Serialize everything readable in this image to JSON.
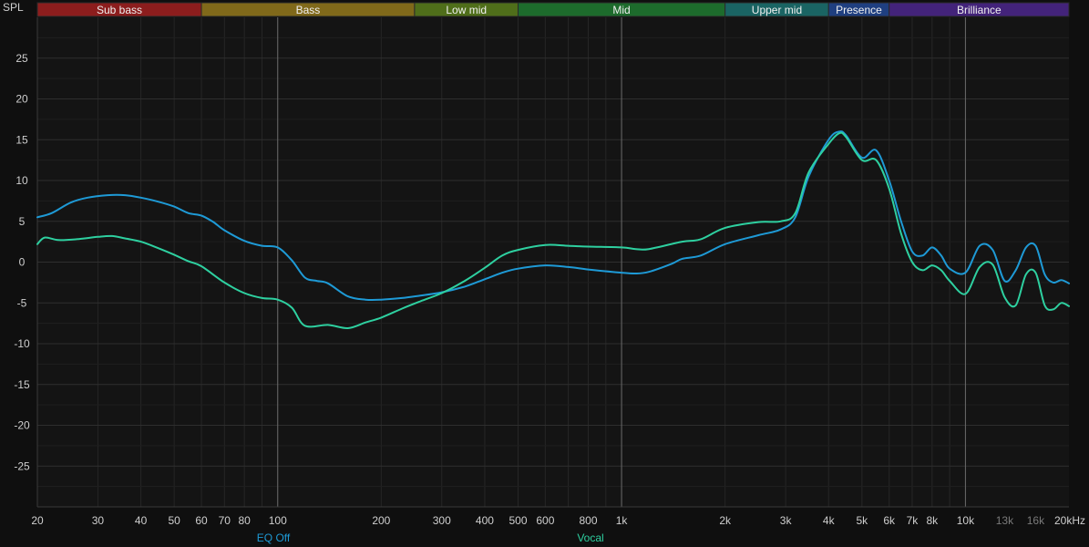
{
  "chart_data": {
    "type": "line",
    "ylabel": "SPL",
    "xscale": "log",
    "xlim": [
      20,
      20000
    ],
    "ylim": [
      -30,
      30
    ],
    "grid": true,
    "bands": [
      {
        "label": "Sub bass",
        "from": 20,
        "to": 60,
        "color": "#8c1d1d"
      },
      {
        "label": "Bass",
        "from": 60,
        "to": 250,
        "color": "#80691a"
      },
      {
        "label": "Low mid",
        "from": 250,
        "to": 500,
        "color": "#4f6e1a"
      },
      {
        "label": "Mid",
        "from": 500,
        "to": 2000,
        "color": "#1d6b2c"
      },
      {
        "label": "Upper mid",
        "from": 2000,
        "to": 4000,
        "color": "#1a6463"
      },
      {
        "label": "Presence",
        "from": 4000,
        "to": 6000,
        "color": "#1f3f80"
      },
      {
        "label": "Brilliance",
        "from": 6000,
        "to": 20000,
        "color": "#43237a"
      }
    ],
    "yticks": [
      {
        "value": 25,
        "label": "25"
      },
      {
        "value": 20,
        "label": "20"
      },
      {
        "value": 15,
        "label": "15"
      },
      {
        "value": 10,
        "label": "10"
      },
      {
        "value": 5,
        "label": "5"
      },
      {
        "value": 0,
        "label": "0"
      },
      {
        "value": -5,
        "label": "-5"
      },
      {
        "value": -10,
        "label": "-10"
      },
      {
        "value": -15,
        "label": "-15"
      },
      {
        "value": -20,
        "label": "-20"
      },
      {
        "value": -25,
        "label": "-25"
      }
    ],
    "xticks": [
      {
        "value": 20,
        "label": "20"
      },
      {
        "value": 30,
        "label": "30"
      },
      {
        "value": 40,
        "label": "40"
      },
      {
        "value": 50,
        "label": "50"
      },
      {
        "value": 60,
        "label": "60"
      },
      {
        "value": 70,
        "label": "70"
      },
      {
        "value": 80,
        "label": "80"
      },
      {
        "value": 100,
        "label": "100"
      },
      {
        "value": 200,
        "label": "200"
      },
      {
        "value": 300,
        "label": "300"
      },
      {
        "value": 400,
        "label": "400"
      },
      {
        "value": 500,
        "label": "500"
      },
      {
        "value": 600,
        "label": "600"
      },
      {
        "value": 800,
        "label": "800"
      },
      {
        "value": 1000,
        "label": "1k"
      },
      {
        "value": 2000,
        "label": "2k"
      },
      {
        "value": 3000,
        "label": "3k"
      },
      {
        "value": 4000,
        "label": "4k"
      },
      {
        "value": 5000,
        "label": "5k"
      },
      {
        "value": 6000,
        "label": "6k"
      },
      {
        "value": 7000,
        "label": "7k"
      },
      {
        "value": 8000,
        "label": "8k"
      },
      {
        "value": 10000,
        "label": "10k"
      },
      {
        "value": 13000,
        "label": "13k",
        "dim": true
      },
      {
        "value": 16000,
        "label": "16k",
        "dim": true
      },
      {
        "value": 20000,
        "label": "20kHz"
      }
    ],
    "series": [
      {
        "name": "EQ Off",
        "color": "#1e9ad6",
        "x": [
          20,
          22,
          25,
          28,
          32,
          36,
          40,
          45,
          50,
          55,
          60,
          65,
          70,
          80,
          90,
          100,
          110,
          120,
          130,
          140,
          160,
          180,
          200,
          230,
          260,
          300,
          350,
          400,
          450,
          500,
          600,
          700,
          800,
          1000,
          1100,
          1200,
          1400,
          1500,
          1700,
          2000,
          2500,
          2900,
          3200,
          3500,
          4000,
          4300,
          4500,
          5000,
          5500,
          6000,
          6500,
          7000,
          7500,
          8000,
          8500,
          9000,
          10000,
          11000,
          12000,
          13000,
          14000,
          15000,
          16000,
          17000,
          18000,
          19000,
          20000
        ],
        "y": [
          5.5,
          6.0,
          7.3,
          7.9,
          8.2,
          8.2,
          7.9,
          7.4,
          6.8,
          6.0,
          5.7,
          4.9,
          3.9,
          2.6,
          2.0,
          1.8,
          0.2,
          -1.9,
          -2.3,
          -2.6,
          -4.2,
          -4.6,
          -4.6,
          -4.4,
          -4.1,
          -3.7,
          -3.0,
          -2.1,
          -1.3,
          -0.8,
          -0.4,
          -0.6,
          -0.9,
          -1.3,
          -1.4,
          -1.2,
          -0.2,
          0.4,
          0.8,
          2.2,
          3.3,
          4.0,
          5.5,
          10.5,
          15.0,
          16.0,
          15.5,
          12.8,
          13.7,
          10.0,
          5.0,
          1.3,
          0.8,
          1.8,
          0.8,
          -0.8,
          -1.3,
          2.0,
          1.5,
          -2.3,
          -1.0,
          1.8,
          2.0,
          -1.5,
          -2.5,
          -2.2,
          -2.6
        ]
      },
      {
        "name": "Vocal",
        "color": "#2ed0a0",
        "x": [
          20,
          21,
          23,
          26,
          30,
          33,
          36,
          40,
          45,
          50,
          55,
          60,
          70,
          80,
          90,
          100,
          110,
          120,
          140,
          160,
          180,
          200,
          230,
          260,
          300,
          350,
          400,
          450,
          500,
          600,
          700,
          800,
          1000,
          1100,
          1200,
          1500,
          1700,
          2000,
          2500,
          2900,
          3200,
          3500,
          4000,
          4300,
          4500,
          5000,
          5500,
          6000,
          6500,
          7000,
          7500,
          8000,
          8500,
          9000,
          10000,
          11000,
          12000,
          13000,
          14000,
          15000,
          16000,
          17000,
          18000,
          19000,
          20000
        ],
        "y": [
          2.2,
          3.0,
          2.7,
          2.8,
          3.1,
          3.2,
          2.9,
          2.5,
          1.7,
          0.9,
          0.1,
          -0.5,
          -2.5,
          -3.8,
          -4.4,
          -4.6,
          -5.6,
          -7.8,
          -7.7,
          -8.1,
          -7.4,
          -6.8,
          -5.7,
          -4.8,
          -3.8,
          -2.3,
          -0.7,
          0.8,
          1.5,
          2.1,
          2.0,
          1.9,
          1.8,
          1.6,
          1.6,
          2.5,
          2.8,
          4.2,
          4.9,
          5.0,
          6.0,
          11.0,
          14.5,
          15.8,
          15.3,
          12.5,
          12.5,
          9.0,
          3.5,
          0.0,
          -1.0,
          -0.4,
          -1.0,
          -2.3,
          -3.9,
          -0.6,
          -0.3,
          -4.3,
          -5.3,
          -1.5,
          -1.3,
          -5.3,
          -5.8,
          -5.0,
          -5.4
        ]
      }
    ]
  }
}
